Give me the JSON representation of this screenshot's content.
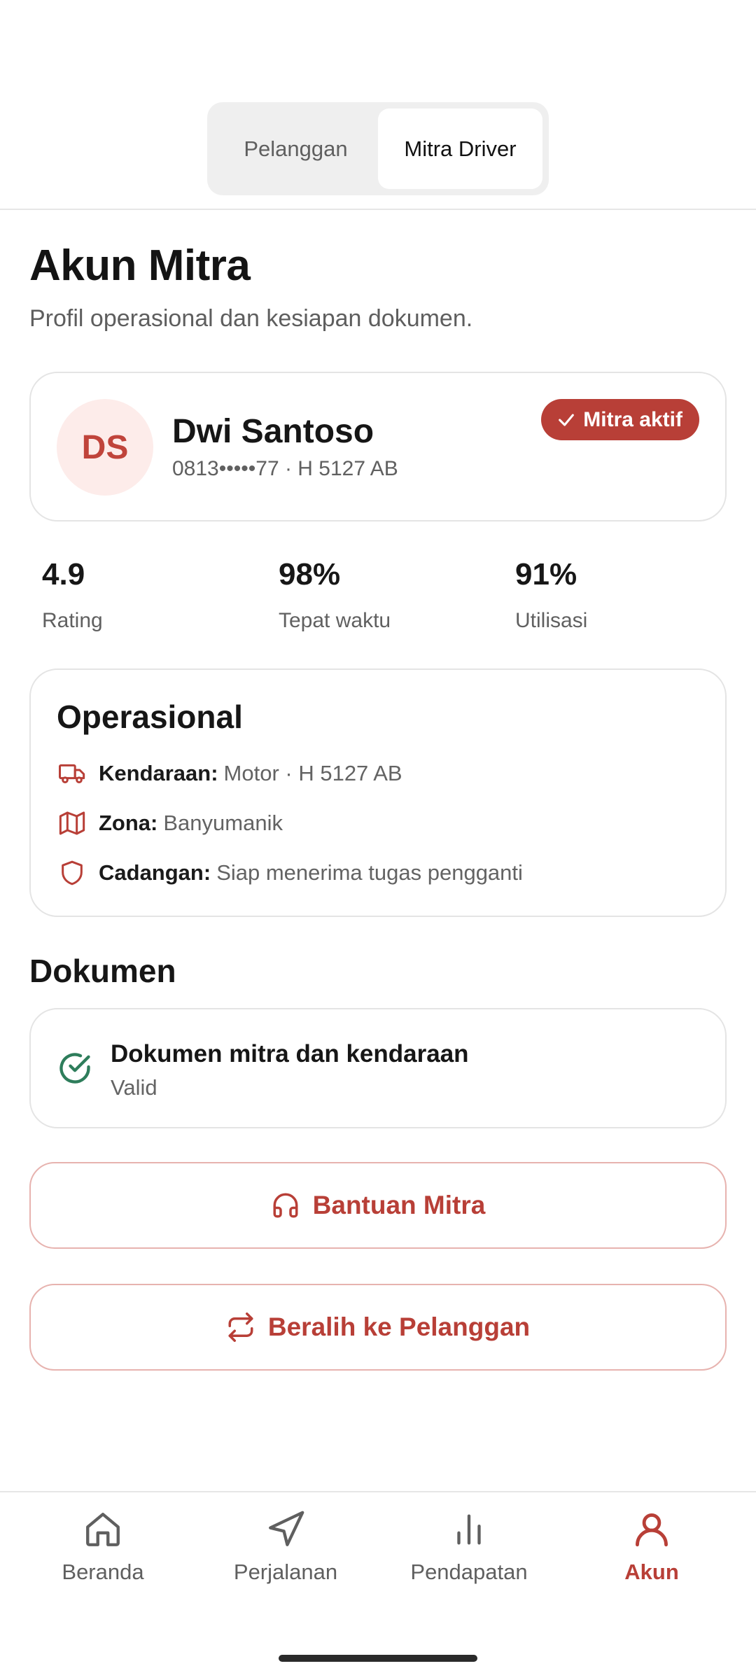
{
  "role_switch": {
    "options": [
      {
        "label": "Pelanggan",
        "active": false
      },
      {
        "label": "Mitra Driver",
        "active": true
      }
    ]
  },
  "header": {
    "title": "Akun Mitra",
    "subtitle": "Profil operasional dan kesiapan dokumen."
  },
  "profile": {
    "initials": "DS",
    "name": "Dwi Santoso",
    "meta": "0813•••••77 · H 5127 AB",
    "status_badge": "Mitra aktif",
    "status_icon": "check-icon"
  },
  "stats": [
    {
      "value": "4.9",
      "label": "Rating"
    },
    {
      "value": "98%",
      "label": "Tepat waktu"
    },
    {
      "value": "91%",
      "label": "Utilisasi"
    }
  ],
  "operational": {
    "title": "Operasional",
    "rows": [
      {
        "icon": "truck-icon",
        "label": "Kendaraan:",
        "value": "Motor · H 5127 AB"
      },
      {
        "icon": "map-icon",
        "label": "Zona:",
        "value": "Banyumanik"
      },
      {
        "icon": "shield-icon",
        "label": "Cadangan:",
        "value": "Siap menerima tugas pengganti"
      }
    ]
  },
  "documents": {
    "section_title": "Dokumen",
    "items": [
      {
        "icon": "check-circle-icon",
        "title": "Dokumen mitra dan kendaraan",
        "status": "Valid"
      }
    ]
  },
  "actions": {
    "help_label": "Bantuan Mitra",
    "help_icon": "headphones-icon",
    "switch_label": "Beralih ke Pelanggan",
    "switch_icon": "repeat-icon"
  },
  "bottom_nav": {
    "items": [
      {
        "label": "Beranda",
        "icon": "home-icon",
        "active": false
      },
      {
        "label": "Perjalanan",
        "icon": "navigation-icon",
        "active": false
      },
      {
        "label": "Pendapatan",
        "icon": "bar-chart-icon",
        "active": false
      },
      {
        "label": "Akun",
        "icon": "user-icon",
        "active": true
      }
    ]
  },
  "colors": {
    "accent": "#b83f37",
    "avatar_bg": "#fdecea",
    "success": "#2e7d5b",
    "muted_text": "#606060"
  }
}
